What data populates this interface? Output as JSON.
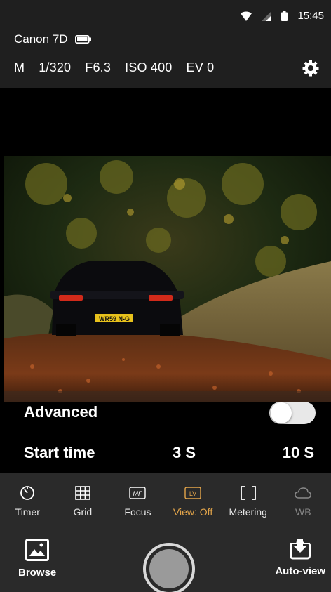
{
  "status_bar": {
    "time": "15:45",
    "icons": [
      "wifi-icon",
      "signal-icon",
      "battery-icon"
    ]
  },
  "camera": {
    "name": "Canon 7D",
    "battery_icon": "battery-icon"
  },
  "exposure": {
    "mode": "M",
    "shutter": "1/320",
    "aperture": "F6.3",
    "iso": "ISO 400",
    "ev": "EV 0",
    "settings_icon": "gear-icon"
  },
  "advanced": {
    "label": "Advanced",
    "enabled": false
  },
  "start_time": {
    "label": "Start time",
    "value": "3 S",
    "end_value": "10 S"
  },
  "toolbar": [
    {
      "label": "Timer",
      "icon": "timer-icon",
      "state": "normal"
    },
    {
      "label": "Grid",
      "icon": "grid-icon",
      "state": "normal"
    },
    {
      "label": "Focus",
      "icon": "mf-icon",
      "state": "normal"
    },
    {
      "label": "View: Off",
      "icon": "lv-icon",
      "state": "active"
    },
    {
      "label": "Metering",
      "icon": "metering-icon",
      "state": "normal"
    },
    {
      "label": "WB",
      "icon": "cloud-icon",
      "state": "disabled"
    }
  ],
  "bottom": {
    "browse_label": "Browse",
    "autoview_label": "Auto-view"
  },
  "photo": {
    "plate_text": "WR59 N-G"
  },
  "colors": {
    "active": "#e3a54a",
    "panel": "#2a2a2a",
    "header": "#1f1f1f"
  }
}
